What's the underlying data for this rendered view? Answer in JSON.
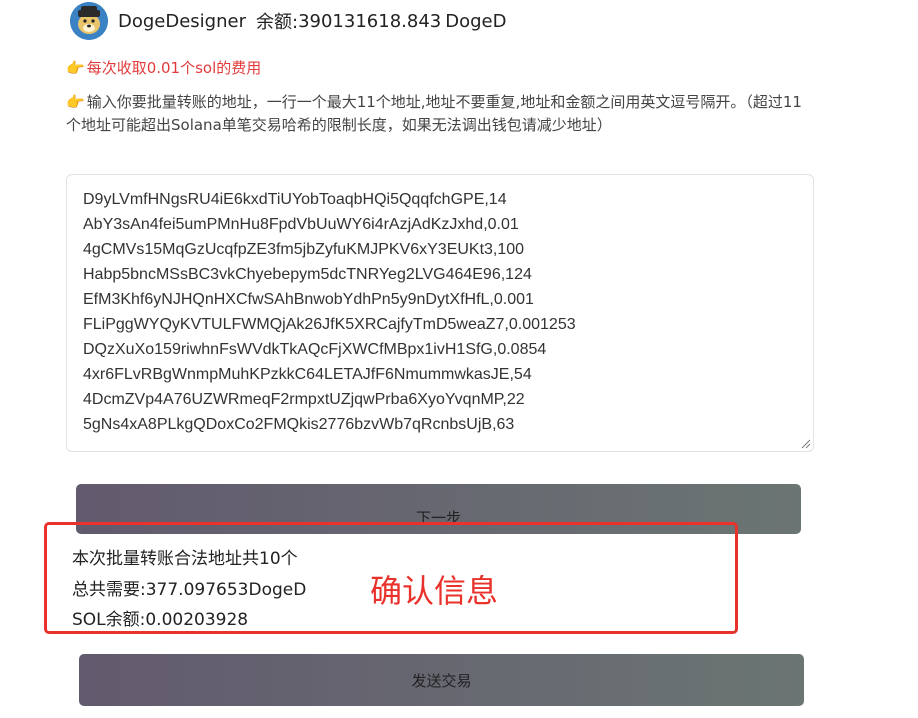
{
  "header": {
    "username": "DogeDesigner",
    "balance_label": "余额:",
    "balance_value": "390131618.843",
    "balance_unit": "DogeD"
  },
  "notes": {
    "hand_icon": "👉",
    "fee_note": "每次收取0.01个sol的费用",
    "instruction": "输入你要批量转账的地址，一行一个最大11个地址,地址不要重复,地址和金额之间用英文逗号隔开。（超过11个地址可能超出Solana单笔交易哈希的限制长度，如果无法调出钱包请减少地址）"
  },
  "addresses": [
    "D9yLVmfHNgsRU4iE6kxdTiUYobToaqbHQi5QqqfchGPE,14",
    "AbY3sAn4fei5umPMnHu8FpdVbUuWY6i4rAzjAdKzJxhd,0.01",
    "4gCMVs15MqGzUcqfpZE3fm5jbZyfuKMJPKV6xY3EUKt3,100",
    "Habp5bncMSsBC3vkChyebepym5dcTNRYeg2LVG464E96,124",
    "EfM3Khf6yNJHQnHXCfwSAhBnwobYdhPn5y9nDytXfHfL,0.001",
    "FLiPggWYQyKVTULFWMQjAk26JfK5XRCajfyTmD5weaZ7,0.001253",
    "DQzXuXo159riwhnFsWVdkTkAQcFjXWCfMBpx1ivH1SfG,0.0854",
    "4xr6FLvRBgWnmpMuhKPzkkC64LETAJfF6NmummwkasJE,54",
    "4DcmZVp4A76UZWRmeqF2rmpxtUZjqwPrba6XyoYvqnMP,22",
    "5gNs4xA8PLkgQDoxCo2FMQkis2776bzvWb7qRcnbsUjB,63"
  ],
  "buttons": {
    "next": "下一步",
    "send": "发送交易"
  },
  "confirm": {
    "count_line": "本次批量转账合法地址共10个",
    "total_line": "总共需要:377.097653DogeD",
    "sol_line": "SOL余额:0.00203928",
    "annotation": "确认信息"
  },
  "colors": {
    "accent_red": "#e8322b",
    "button_gradient_start": "#625a6e",
    "button_gradient_end": "#6b7573"
  }
}
